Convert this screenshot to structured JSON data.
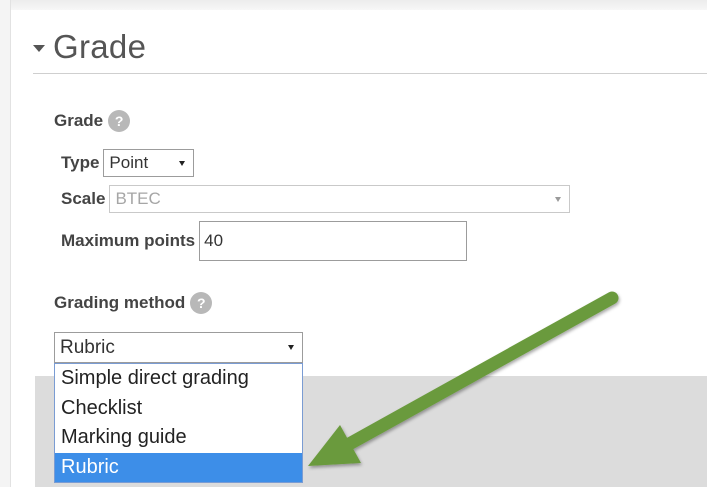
{
  "section": {
    "title": "Grade"
  },
  "grade": {
    "label": "Grade",
    "help_glyph": "?",
    "type_label": "Type",
    "type_value": "Point",
    "scale_label": "Scale",
    "scale_value": "BTEC",
    "max_points_label": "Maximum points",
    "max_points_value": "40"
  },
  "grading_method": {
    "label": "Grading method",
    "help_glyph": "?",
    "selected": "Rubric",
    "options": [
      "Simple direct grading",
      "Checklist",
      "Marking guide",
      "Rubric"
    ]
  },
  "annotation": {
    "arrow_color": "#6a9a3c"
  },
  "colors": {
    "selected_option_bg": "#3d8ee8",
    "dropdown_border": "#7a9cd3"
  }
}
